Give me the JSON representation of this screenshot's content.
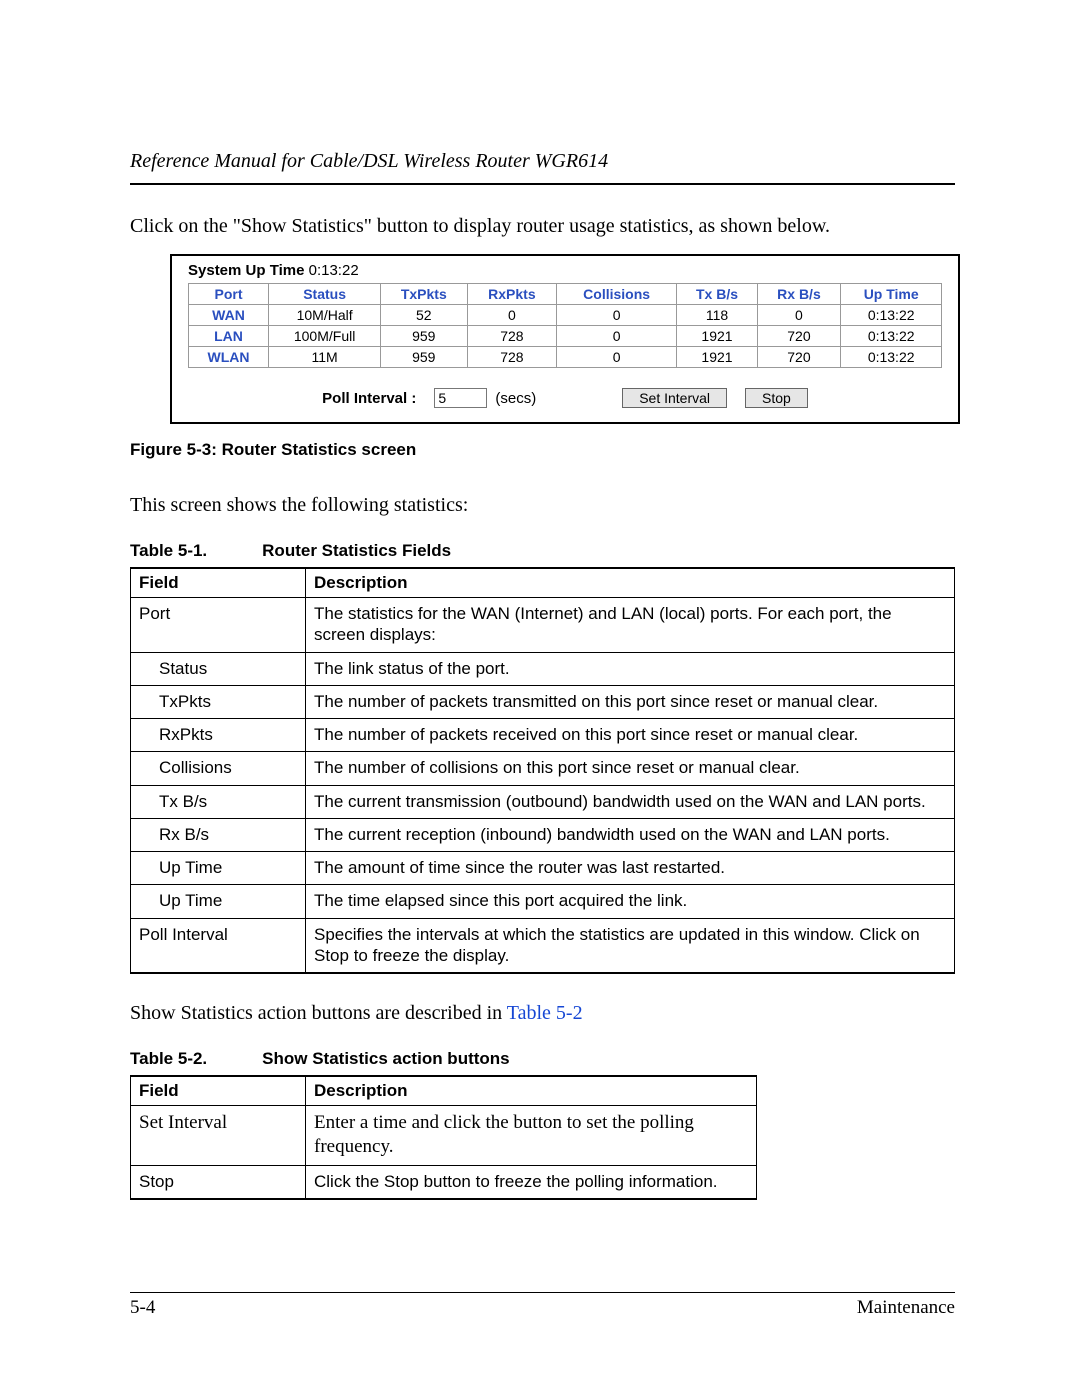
{
  "running_head": "Reference Manual for Cable/DSL Wireless Router WGR614",
  "intro": "Click on the \"Show Statistics\" button to display router usage statistics, as shown below.",
  "screenshot": {
    "uptime_label": "System Up Time",
    "uptime_value": "0:13:22",
    "headers": [
      "Port",
      "Status",
      "TxPkts",
      "RxPkts",
      "Collisions",
      "Tx B/s",
      "Rx B/s",
      "Up Time"
    ],
    "rows": [
      {
        "port": "WAN",
        "status": "10M/Half",
        "tx": "52",
        "rx": "0",
        "col": "0",
        "txbs": "118",
        "rxbs": "0",
        "up": "0:13:22"
      },
      {
        "port": "LAN",
        "status": "100M/Full",
        "tx": "959",
        "rx": "728",
        "col": "0",
        "txbs": "1921",
        "rxbs": "720",
        "up": "0:13:22"
      },
      {
        "port": "WLAN",
        "status": "11M",
        "tx": "959",
        "rx": "728",
        "col": "0",
        "txbs": "1921",
        "rxbs": "720",
        "up": "0:13:22"
      }
    ],
    "poll_label": "Poll Interval :",
    "poll_value": "5",
    "secs": "(secs)",
    "set_btn": "Set Interval",
    "stop_btn": "Stop"
  },
  "figure_caption": "Figure 5-3:  Router Statistics screen",
  "para2": "This screen shows the following statistics:",
  "table1": {
    "caption_num": "Table 5-1.",
    "caption_title": "Router Statistics Fields",
    "head_field": "Field",
    "head_desc": "Description",
    "rows": [
      {
        "field": "Port",
        "indent": false,
        "desc": "The statistics for the WAN (Internet) and LAN (local) ports. For each port, the screen displays:"
      },
      {
        "field": "Status",
        "indent": true,
        "desc": "The link status of the port."
      },
      {
        "field": "TxPkts",
        "indent": true,
        "desc": "The number of packets transmitted on this port since reset or manual clear."
      },
      {
        "field": "RxPkts",
        "indent": true,
        "desc": "The number of packets received on this port since reset or manual clear."
      },
      {
        "field": "Collisions",
        "indent": true,
        "desc": "The number of collisions on this port since reset or manual clear."
      },
      {
        "field": "Tx B/s",
        "indent": true,
        "desc": "The current transmission (outbound) bandwidth used on the WAN and LAN ports."
      },
      {
        "field": "Rx B/s",
        "indent": true,
        "desc": "The current reception (inbound) bandwidth used on the WAN and LAN ports."
      },
      {
        "field": "Up Time",
        "indent": true,
        "desc": "The amount of time since the router was last restarted."
      },
      {
        "field": "Up Time",
        "indent": true,
        "desc": "The time elapsed since this port acquired the link."
      },
      {
        "field": "Poll Interval",
        "indent": false,
        "desc": "Specifies the intervals at which the statistics are updated in this window. Click on Stop to freeze the display."
      }
    ]
  },
  "para3_pre": "Show Statistics action buttons are described in ",
  "para3_link": "Table 5-2",
  "table2": {
    "caption_num": "Table 5-2.",
    "caption_title": "Show Statistics action buttons",
    "head_field": "Field",
    "head_desc": "Description",
    "rows": [
      {
        "field": "Set Interval",
        "serif": true,
        "desc": "Enter a time and click the button to set the polling frequency."
      },
      {
        "field": "Stop",
        "serif": false,
        "desc": "Click the Stop button to freeze the polling information."
      }
    ]
  },
  "footer": {
    "left": "5-4",
    "right": "Maintenance"
  }
}
